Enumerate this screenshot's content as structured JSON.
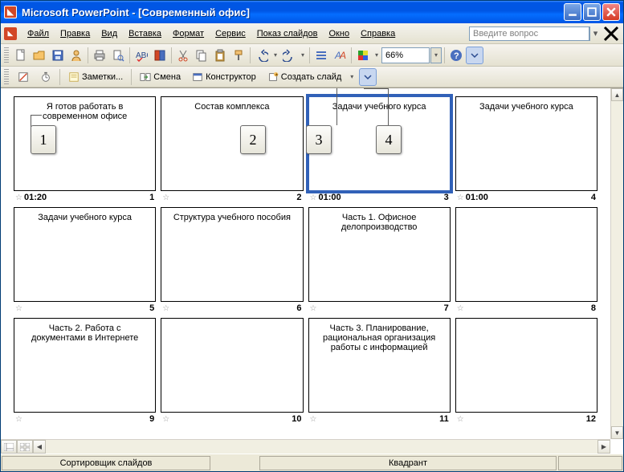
{
  "titlebar": {
    "text": "Microsoft PowerPoint - [Современный офис]"
  },
  "menubar": {
    "file": "Файл",
    "edit": "Правка",
    "view": "Вид",
    "insert": "Вставка",
    "format": "Формат",
    "service": "Сервис",
    "slideshow": "Показ слайдов",
    "window": "Окно",
    "help": "Справка",
    "question_placeholder": "Введите вопрос"
  },
  "toolbar": {
    "zoom": "66%"
  },
  "toolbar2": {
    "notes": "Заметки...",
    "rehearse": "Смена",
    "design": "Конструктор",
    "new_slide": "Создать слайд"
  },
  "slides": [
    {
      "title": "Я готов работать в современном офисе",
      "time": "01:20",
      "num": "1",
      "selected": false,
      "has_time": true
    },
    {
      "title": "Состав комплекса",
      "time": "",
      "num": "2",
      "selected": false,
      "has_time": false
    },
    {
      "title": "Задачи учебного курса",
      "time": "01:00",
      "num": "3",
      "selected": true,
      "has_time": true
    },
    {
      "title": "Задачи учебного курса",
      "time": "01:00",
      "num": "4",
      "selected": false,
      "has_time": true
    },
    {
      "title": "Задачи учебного курса",
      "time": "",
      "num": "5",
      "selected": false,
      "has_time": false
    },
    {
      "title": "Структура учебного пособия",
      "time": "",
      "num": "6",
      "selected": false,
      "has_time": false
    },
    {
      "title": "Часть 1. Офисное делопроизводство",
      "time": "",
      "num": "7",
      "selected": false,
      "has_time": false
    },
    {
      "title": "",
      "time": "",
      "num": "8",
      "selected": false,
      "has_time": false
    },
    {
      "title": "Часть 2. Работа с документами в Интернете",
      "time": "",
      "num": "9",
      "selected": false,
      "has_time": false
    },
    {
      "title": "",
      "time": "",
      "num": "10",
      "selected": false,
      "has_time": false
    },
    {
      "title": "Часть 3. Планирование, рациональная организация работы с информацией",
      "time": "",
      "num": "11",
      "selected": false,
      "has_time": false
    },
    {
      "title": "",
      "time": "",
      "num": "12",
      "selected": false,
      "has_time": false
    }
  ],
  "status": {
    "left": "Сортировщик слайдов",
    "center": "Квадрант"
  },
  "callouts": {
    "c1": "1",
    "c2": "2",
    "c3": "3",
    "c4": "4"
  }
}
